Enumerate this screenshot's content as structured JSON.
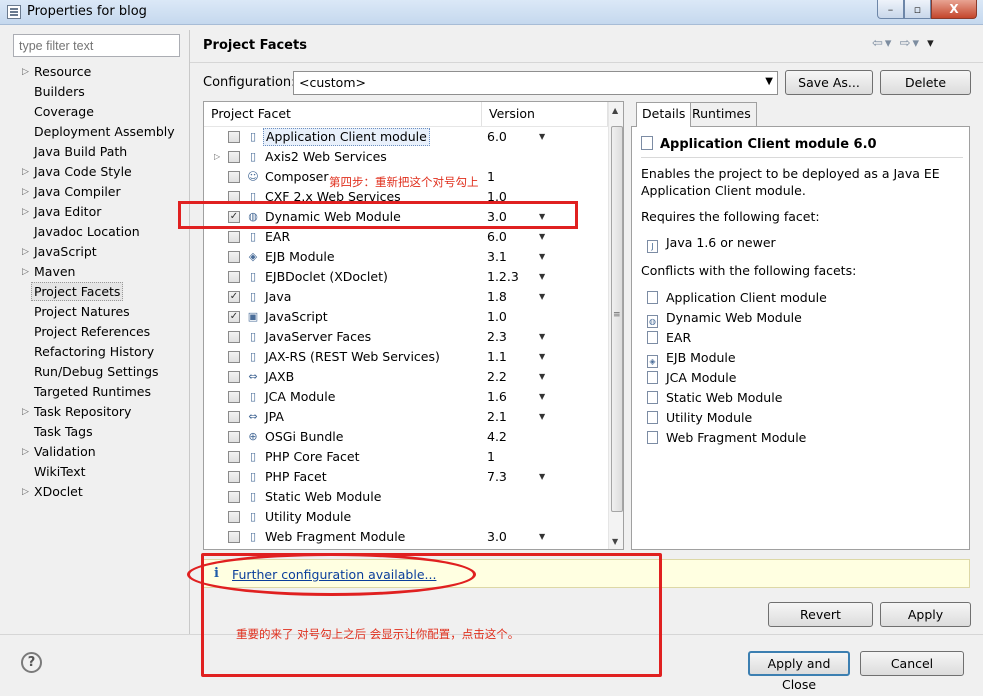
{
  "window": {
    "title": "Properties for blog",
    "minimize": "–",
    "maximize": "▫",
    "close": "X"
  },
  "filter": {
    "placeholder": "type filter text"
  },
  "nav": {
    "items": [
      {
        "label": "Resource",
        "expandable": true
      },
      {
        "label": "Builders",
        "expandable": false
      },
      {
        "label": "Coverage",
        "expandable": false
      },
      {
        "label": "Deployment Assembly",
        "expandable": false
      },
      {
        "label": "Java Build Path",
        "expandable": false
      },
      {
        "label": "Java Code Style",
        "expandable": true
      },
      {
        "label": "Java Compiler",
        "expandable": true
      },
      {
        "label": "Java Editor",
        "expandable": true
      },
      {
        "label": "Javadoc Location",
        "expandable": false
      },
      {
        "label": "JavaScript",
        "expandable": true
      },
      {
        "label": "Maven",
        "expandable": true
      },
      {
        "label": "Project Facets",
        "expandable": false,
        "selected": true
      },
      {
        "label": "Project Natures",
        "expandable": false
      },
      {
        "label": "Project References",
        "expandable": false
      },
      {
        "label": "Refactoring History",
        "expandable": false
      },
      {
        "label": "Run/Debug Settings",
        "expandable": false
      },
      {
        "label": "Targeted Runtimes",
        "expandable": false
      },
      {
        "label": "Task Repository",
        "expandable": true
      },
      {
        "label": "Task Tags",
        "expandable": false
      },
      {
        "label": "Validation",
        "expandable": true
      },
      {
        "label": "WikiText",
        "expandable": false
      },
      {
        "label": "XDoclet",
        "expandable": true
      }
    ]
  },
  "page": {
    "title": "Project Facets"
  },
  "config": {
    "label": "Configuration:",
    "value": "<custom>",
    "save_as": "Save As...",
    "delete": "Delete"
  },
  "table": {
    "col_facet": "Project Facet",
    "col_version": "Version",
    "rows": [
      {
        "name": "Application Client module",
        "version": "6.0",
        "checked": false,
        "dd": true,
        "highlight": true,
        "icon": "page-icon"
      },
      {
        "name": "Axis2 Web Services",
        "version": "",
        "checked": false,
        "dd": false,
        "twisty": true,
        "icon": "page-icon"
      },
      {
        "name": "Composer",
        "version": "1",
        "checked": false,
        "dd": false,
        "icon": "composer-icon"
      },
      {
        "name": "CXF 2.x Web Services",
        "version": "1.0",
        "checked": false,
        "dd": false,
        "icon": "page-icon"
      },
      {
        "name": "Dynamic Web Module",
        "version": "3.0",
        "checked": true,
        "dd": true,
        "icon": "globe-icon"
      },
      {
        "name": "EAR",
        "version": "6.0",
        "checked": false,
        "dd": true,
        "icon": "page-icon"
      },
      {
        "name": "EJB Module",
        "version": "3.1",
        "checked": false,
        "dd": true,
        "icon": "ejb-icon"
      },
      {
        "name": "EJBDoclet (XDoclet)",
        "version": "1.2.3",
        "checked": false,
        "dd": true,
        "icon": "page-icon"
      },
      {
        "name": "Java",
        "version": "1.8",
        "checked": true,
        "dd": true,
        "icon": "page-icon"
      },
      {
        "name": "JavaScript",
        "version": "1.0",
        "checked": true,
        "dd": false,
        "icon": "js-icon"
      },
      {
        "name": "JavaServer Faces",
        "version": "2.3",
        "checked": false,
        "dd": true,
        "icon": "page-icon"
      },
      {
        "name": "JAX-RS (REST Web Services)",
        "version": "1.1",
        "checked": false,
        "dd": true,
        "icon": "page-icon"
      },
      {
        "name": "JAXB",
        "version": "2.2",
        "checked": false,
        "dd": true,
        "icon": "jaxb-icon"
      },
      {
        "name": "JCA Module",
        "version": "1.6",
        "checked": false,
        "dd": true,
        "icon": "page-icon"
      },
      {
        "name": "JPA",
        "version": "2.1",
        "checked": false,
        "dd": true,
        "icon": "jpa-icon"
      },
      {
        "name": "OSGi Bundle",
        "version": "4.2",
        "checked": false,
        "dd": false,
        "icon": "osgi-icon"
      },
      {
        "name": "PHP Core Facet",
        "version": "1",
        "checked": false,
        "dd": false,
        "icon": "page-icon"
      },
      {
        "name": "PHP Facet",
        "version": "7.3",
        "checked": false,
        "dd": true,
        "icon": "page-icon"
      },
      {
        "name": "Static Web Module",
        "version": "",
        "checked": false,
        "dd": false,
        "icon": "page-icon"
      },
      {
        "name": "Utility Module",
        "version": "",
        "checked": false,
        "dd": false,
        "icon": "page-icon"
      },
      {
        "name": "Web Fragment Module",
        "version": "3.0",
        "checked": false,
        "dd": true,
        "icon": "page-icon"
      }
    ]
  },
  "details": {
    "tab_details": "Details",
    "tab_runtimes": "Runtimes",
    "title": "Application Client module 6.0",
    "description": "Enables the project to be deployed as a Java EE Application Client module.",
    "requires_label": "Requires the following facet:",
    "requires_item": "Java 1.6 or newer",
    "conflicts_label": "Conflicts with the following facets:",
    "conflicts": [
      "Application Client module",
      "Dynamic Web Module",
      "EAR",
      "EJB Module",
      "JCA Module",
      "Static Web Module",
      "Utility Module",
      "Web Fragment Module"
    ]
  },
  "infobar": {
    "icon": "i",
    "link": "Further configuration available..."
  },
  "buttons": {
    "revert": "Revert",
    "apply": "Apply",
    "apply_close": "Apply and Close",
    "cancel": "Cancel",
    "help": "?"
  },
  "annotations": {
    "step4": "第四步：重新把这个对号勾上",
    "note": "重要的来了 对号勾上之后  会显示让你配置，点击这个。"
  },
  "colors": {
    "annotation_red": "#e02020",
    "link_blue": "#0b3e9b",
    "info_bg": "#ffffe1"
  }
}
